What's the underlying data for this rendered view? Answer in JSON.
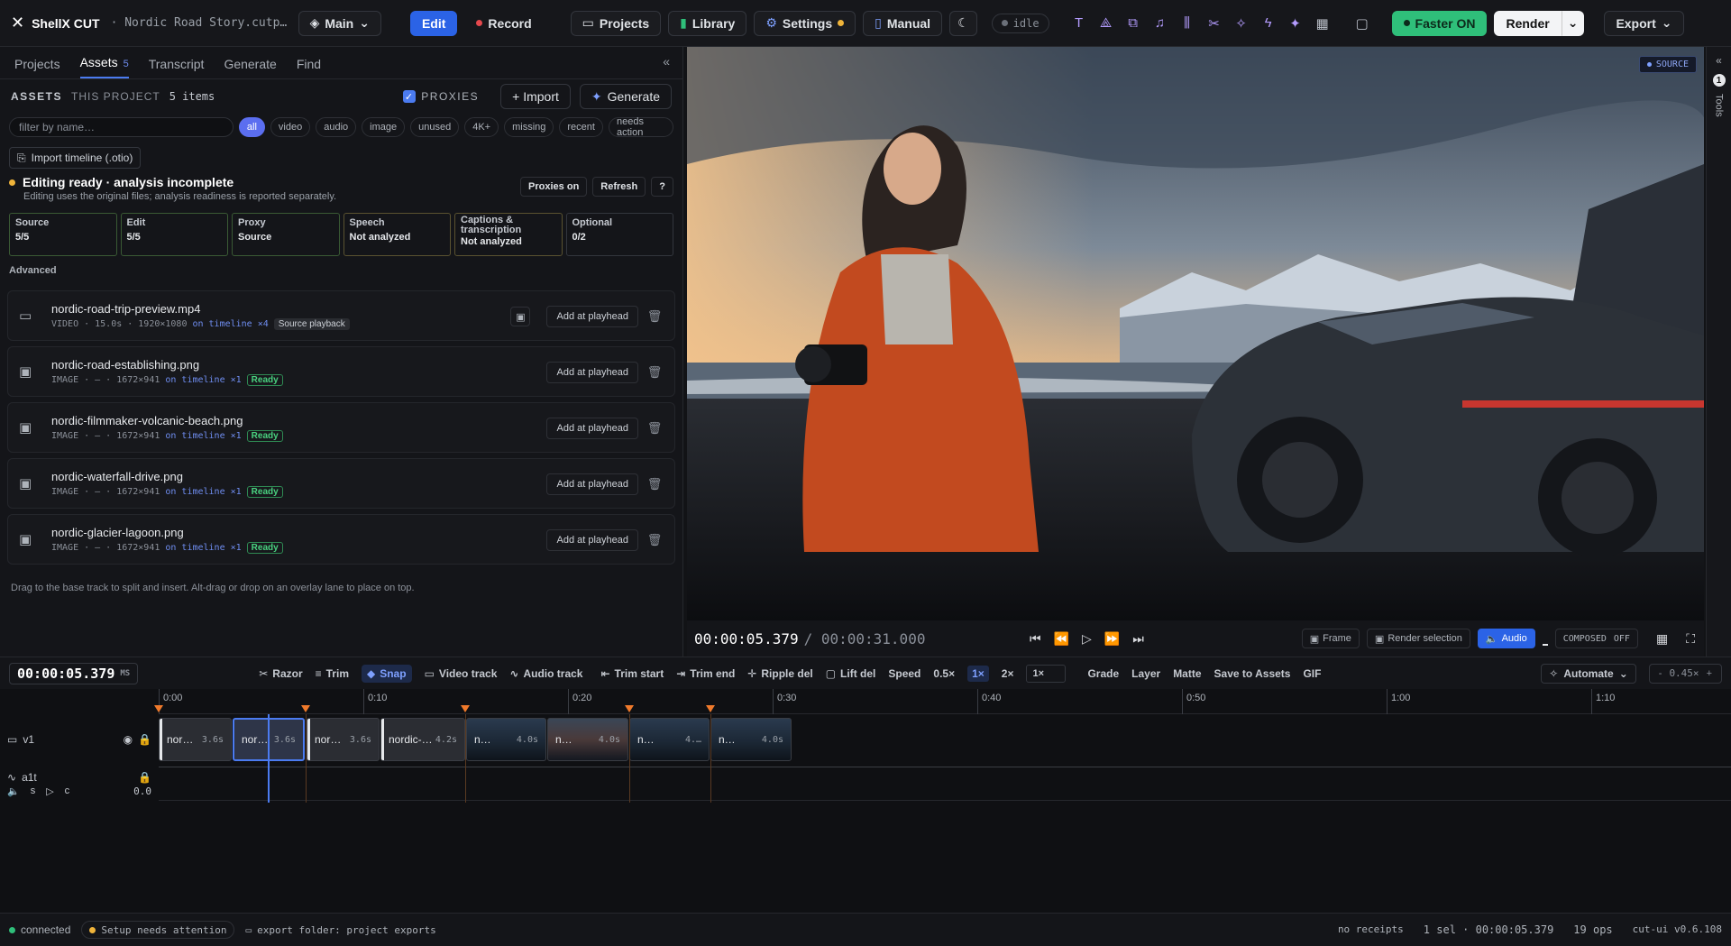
{
  "topbar": {
    "app_name": "ShellX CUT",
    "project_name": "· Nordic Road Story.cutp…",
    "branch": "Main",
    "edit": "Edit",
    "record": "Record",
    "projects": "Projects",
    "library": "Library",
    "settings": "Settings",
    "manual": "Manual",
    "idle": "idle",
    "faster": "Faster ON",
    "render": "Render",
    "export": "Export",
    "colors": {
      "accent": "#2b63e6",
      "green": "#2fbf7a",
      "record": "#e5484d"
    }
  },
  "left": {
    "tabs": [
      {
        "label": "Projects"
      },
      {
        "label": "Assets",
        "badge": "5"
      },
      {
        "label": "Transcript"
      },
      {
        "label": "Generate"
      },
      {
        "label": "Find"
      }
    ],
    "assets_label": "ASSETS",
    "this_project": "THIS PROJECT",
    "items_count": "5 items",
    "proxies": "PROXIES",
    "import": "+ Import",
    "generate": "Generate",
    "filter_placeholder": "filter by name…",
    "chips": [
      "all",
      "video",
      "audio",
      "image",
      "unused",
      "4K+",
      "missing",
      "recent",
      "needs action"
    ],
    "import_timeline": "Import timeline (.otio)",
    "status": {
      "title": "Editing ready · analysis incomplete",
      "desc": "Editing uses the original files; analysis readiness is reported separately.",
      "proxies_on": "Proxies on",
      "refresh": "Refresh",
      "help": "?",
      "cards": [
        {
          "title": "Source",
          "value": "5/5"
        },
        {
          "title": "Edit",
          "value": "5/5"
        },
        {
          "title": "Proxy",
          "value": "Source"
        },
        {
          "title": "Speech",
          "value": "Not analyzed"
        },
        {
          "title": "Captions & transcription",
          "value": "Not analyzed"
        },
        {
          "title": "Optional",
          "value": "0/2"
        }
      ],
      "advanced": "Advanced"
    },
    "assets": [
      {
        "name": "nordic-road-trip-preview.mp4",
        "kind": "VIDEO",
        "dur": "15.0s",
        "res": "1920×1080",
        "timeline": "on timeline ×4",
        "tag": "Source playback"
      },
      {
        "name": "nordic-road-establishing.png",
        "kind": "IMAGE",
        "dur": "–",
        "res": "1672×941",
        "timeline": "on timeline ×1",
        "tag": "Ready"
      },
      {
        "name": "nordic-filmmaker-volcanic-beach.png",
        "kind": "IMAGE",
        "dur": "–",
        "res": "1672×941",
        "timeline": "on timeline ×1",
        "tag": "Ready"
      },
      {
        "name": "nordic-waterfall-drive.png",
        "kind": "IMAGE",
        "dur": "–",
        "res": "1672×941",
        "timeline": "on timeline ×1",
        "tag": "Ready"
      },
      {
        "name": "nordic-glacier-lagoon.png",
        "kind": "IMAGE",
        "dur": "–",
        "res": "1672×941",
        "timeline": "on timeline ×1",
        "tag": "Ready"
      }
    ],
    "add_label": "Add at playhead",
    "hint": "Drag to the base track to split and insert. Alt-drag or drop on an overlay lane to place on top."
  },
  "preview": {
    "badge": "SOURCE",
    "timecode": "00:00:05.379",
    "total": "/ 00:00:31.000",
    "frame": "Frame",
    "render_selection": "Render selection",
    "audio": "Audio",
    "composed": "COMPOSED",
    "composed_state": "OFF"
  },
  "rail": {
    "count": "1",
    "label": "Tools"
  },
  "toolbar": {
    "timecode": "00:00:05.379",
    "unit": "MS",
    "razor": "Razor",
    "trim": "Trim",
    "snap": "Snap",
    "video_track": "Video track",
    "audio_track": "Audio track",
    "trim_start": "Trim start",
    "trim_end": "Trim end",
    "ripple_del": "Ripple del",
    "lift_del": "Lift del",
    "speed": "Speed",
    "speeds": [
      "0.5×",
      "1×",
      "2×"
    ],
    "speed_value": "1×",
    "grade": "Grade",
    "layer": "Layer",
    "matte": "Matte",
    "save_to_assets": "Save to Assets",
    "gif": "GIF",
    "automate": "Automate",
    "zoom": "0.45×"
  },
  "timeline": {
    "ticks": [
      "0:00",
      "0:10",
      "0:20",
      "0:30",
      "0:40",
      "0:50",
      "1:00",
      "1:10"
    ],
    "v1": "v1",
    "a1": "a1t",
    "a1_s": "s",
    "a1_c": "c",
    "a1_val": "0.0",
    "clips": [
      {
        "label": "nor…",
        "dur": "3.6s"
      },
      {
        "label": "nor…",
        "dur": "3.6s"
      },
      {
        "label": "nor…",
        "dur": "3.6s"
      },
      {
        "label": "nordic-…",
        "dur": "4.2s"
      },
      {
        "label": "n…",
        "dur": "4.0s"
      },
      {
        "label": "n…",
        "dur": "4.0s"
      },
      {
        "label": "n…",
        "dur": "4.…"
      },
      {
        "label": "n…",
        "dur": "4.0s"
      }
    ]
  },
  "statusbar": {
    "connected": "connected",
    "setup": "Setup needs attention",
    "export_folder": "export folder: project exports",
    "receipts": "no receipts",
    "selection": "1 sel · 00:00:05.379",
    "ops": "19 ops",
    "version": "cut-ui v0.6.108"
  }
}
